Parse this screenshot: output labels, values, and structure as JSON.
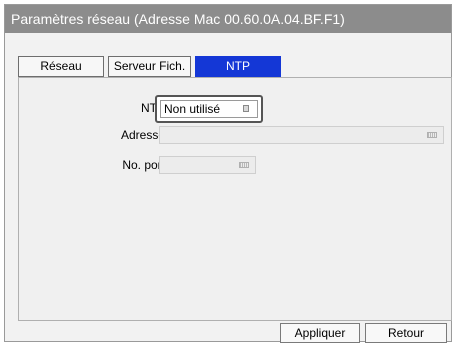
{
  "window": {
    "title": "Paramètres réseau (Adresse Mac 00.60.0A.04.BF.F1)"
  },
  "tabs": [
    {
      "label": "Réseau",
      "active": false
    },
    {
      "label": "Serveur Fich.",
      "active": false
    },
    {
      "label": "NTP",
      "active": true
    }
  ],
  "form": {
    "ntp_label": "NTP",
    "ntp_value": "Non utilisé",
    "adresse_label": "Adresse",
    "adresse_value": "",
    "port_label": "No. port",
    "port_value": ""
  },
  "buttons": {
    "apply": "Appliquer",
    "back": "Retour"
  },
  "colors": {
    "titlebar": "#8c8c8c",
    "active_tab": "#1437d6"
  },
  "icons": {
    "dropdown": "dropdown-indicator-icon",
    "keyboard": "keyboard-icon"
  }
}
